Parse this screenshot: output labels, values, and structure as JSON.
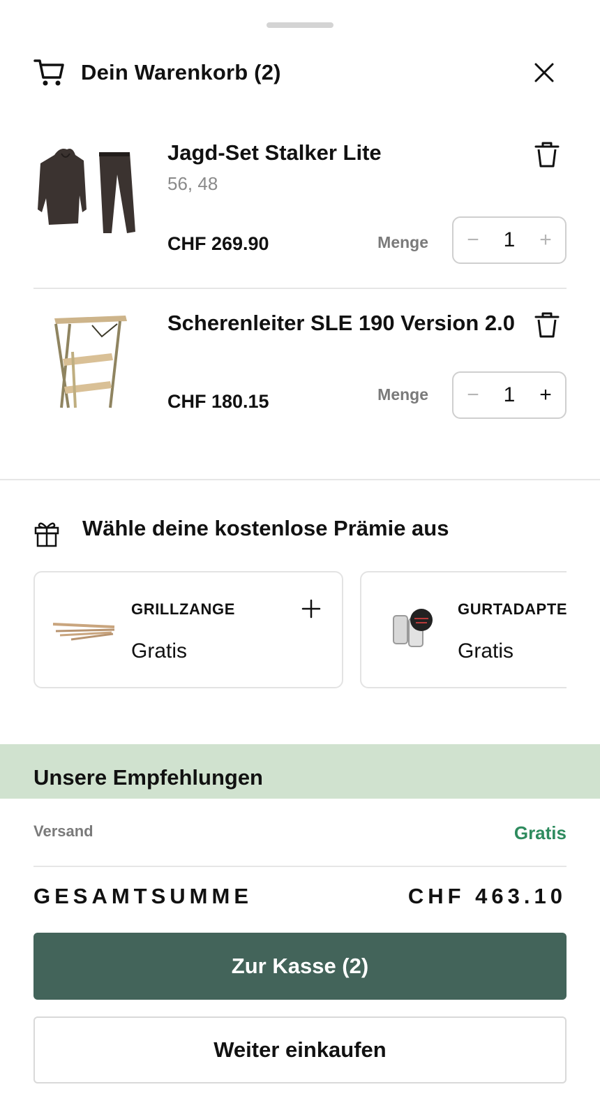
{
  "header": {
    "title": "Dein Warenkorb (2)"
  },
  "items": [
    {
      "name": "Jagd-Set Stalker Lite",
      "variant": "56, 48",
      "price": "CHF 269.90",
      "qty_label": "Menge",
      "qty": "1",
      "image_icon": "hunting-suit-image"
    },
    {
      "name": "Scherenleiter SLE 190 Version 2.0",
      "variant": "",
      "price": "CHF 180.15",
      "qty_label": "Menge",
      "qty": "1",
      "image_icon": "stepladder-image"
    }
  ],
  "rewards": {
    "heading": "Wähle deine kostenlose Prämie aus",
    "cards": [
      {
        "name": "GRILLZANGE",
        "price": "Gratis"
      },
      {
        "name": "GURTADAPTER",
        "price": "Gratis"
      }
    ]
  },
  "recommendations": {
    "heading": "Unsere Empfehlungen"
  },
  "summary": {
    "shipping_label": "Versand",
    "shipping_value": "Gratis",
    "total_label": "GESAMTSUMME",
    "total_value": "CHF 463.10",
    "checkout_label": "Zur Kasse (2)",
    "continue_label": "Weiter einkaufen"
  },
  "colors": {
    "primary": "#43645a",
    "accent_green": "#2e8b5e",
    "reco_bg": "#d0e2cf"
  }
}
